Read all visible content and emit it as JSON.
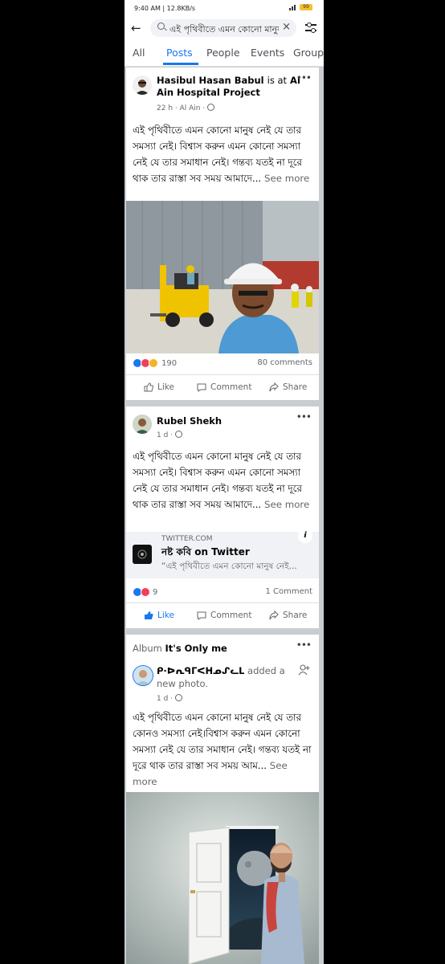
{
  "status": {
    "time": "9:40 AM",
    "speed": "12.8KB/s",
    "battery": "99"
  },
  "search": {
    "query": "এই পৃথিবীতে এমন কোনো মানুষ নেই যে"
  },
  "tabs": [
    "All",
    "Posts",
    "People",
    "Events",
    "Groups"
  ],
  "posts": [
    {
      "author": "Hasibul Hasan Babul",
      "connector": "is at",
      "place": "Al Ain Hospital Project",
      "meta": "22 h · Al Ain ·",
      "text": "এই পৃথিবীতে এমন কোনো মানুষ নেই যে তার সমস্যা নেই। বিশ্বাস করুন এমন কোনো সমস্যা নেই যে তার সমাধান নেই। গন্তব্য যতই না দূরে থাক তার রাস্তা সব সময় আমাদে...",
      "see_more": "See more",
      "reactions": "190",
      "comments": "80 comments",
      "like": "Like",
      "comment": "Comment",
      "share": "Share"
    },
    {
      "author": "Rubel Shekh",
      "meta": "1 d ·",
      "text": "এই পৃথিবীতে এমন কোনো মানুষ নেই যে তার সমস্যা নেই। বিশ্বাস করুন এমন কোনো সমস্যা নেই যে তার সমাধান নেই। গন্তব্য যতই না দূরে থাক তার রাস্তা সব সময় আমাদে...",
      "see_more": "See more",
      "link_domain": "TWITTER.COM",
      "link_title": "নষ্ট কবি on Twitter",
      "link_desc": "“এই পৃথিবীতে এমন কোনো মানুষ নেই...",
      "reactions": "9",
      "comments": "1 Comment",
      "like": "Like",
      "comment": "Comment",
      "share": "Share"
    },
    {
      "album_label": "Album",
      "album_name": "It's Only  me",
      "author": "ᑭ∙ᐅᕆᑫᒥᐸᕼᓄᔑᓚᒪ",
      "action": "added a new photo.",
      "meta": "1 d ·",
      "text": "এই পৃথিবীতে এমন কোনো মানুষ নেই যে তার কোনও সমস্যা নেই।বিশ্বাস করুন এমন কোনো সমস্যা নেই যে তার সমাধান নেই। গন্তব্য যতই না দূরে থাক তার রাস্তা সব সময় আম...",
      "see_more": "See more"
    }
  ],
  "colors": {
    "accent": "#1877f2",
    "divider": "#c9ccd1"
  }
}
